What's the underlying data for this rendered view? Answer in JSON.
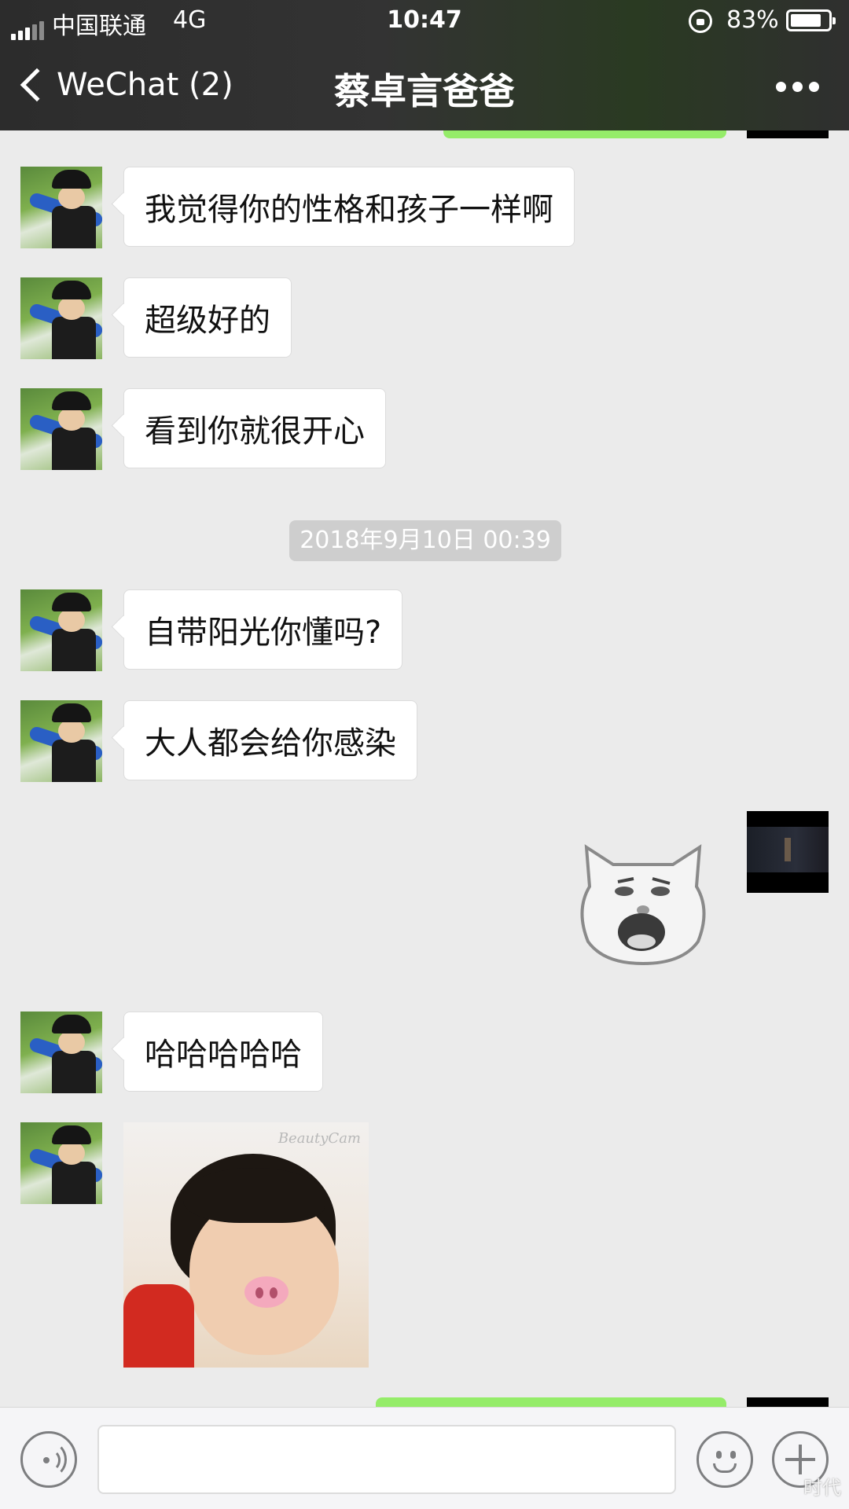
{
  "status_bar": {
    "carrier": "中国联通",
    "network": "4G",
    "time": "10:47",
    "battery_percent": "83%",
    "battery_level": 0.83
  },
  "nav": {
    "back_label": "WeChat (2)",
    "title": "蔡卓言爸爸",
    "more_icon": "more-icon"
  },
  "messages": [
    {
      "sender": "other",
      "type": "text",
      "text": "我觉得你的性格和孩子一样啊"
    },
    {
      "sender": "other",
      "type": "text",
      "text": "超级好的"
    },
    {
      "sender": "other",
      "type": "text",
      "text": "看到你就很开心"
    },
    {
      "type": "timestamp",
      "text": "2018年9月10日 00:39"
    },
    {
      "sender": "other",
      "type": "text",
      "text": "自带阳光你懂吗?"
    },
    {
      "sender": "other",
      "type": "text",
      "text": "大人都会给你感染"
    },
    {
      "sender": "self",
      "type": "sticker",
      "icon": "pig-face-sticker"
    },
    {
      "sender": "other",
      "type": "text",
      "text": "哈哈哈哈哈"
    },
    {
      "sender": "other",
      "type": "image",
      "icon": "baby-pig-nose-photo",
      "watermark": "BeautyCam"
    }
  ],
  "input_bar": {
    "voice_icon": "voice-icon",
    "emoji_icon": "emoji-icon",
    "plus_icon": "plus-icon",
    "watermark": "时代"
  },
  "colors": {
    "nav_bg": "#2c2c2c",
    "chat_bg": "#ebebeb",
    "self_bubble": "#95ec69",
    "other_bubble": "#ffffff",
    "timestamp_bg": "#cecece"
  }
}
